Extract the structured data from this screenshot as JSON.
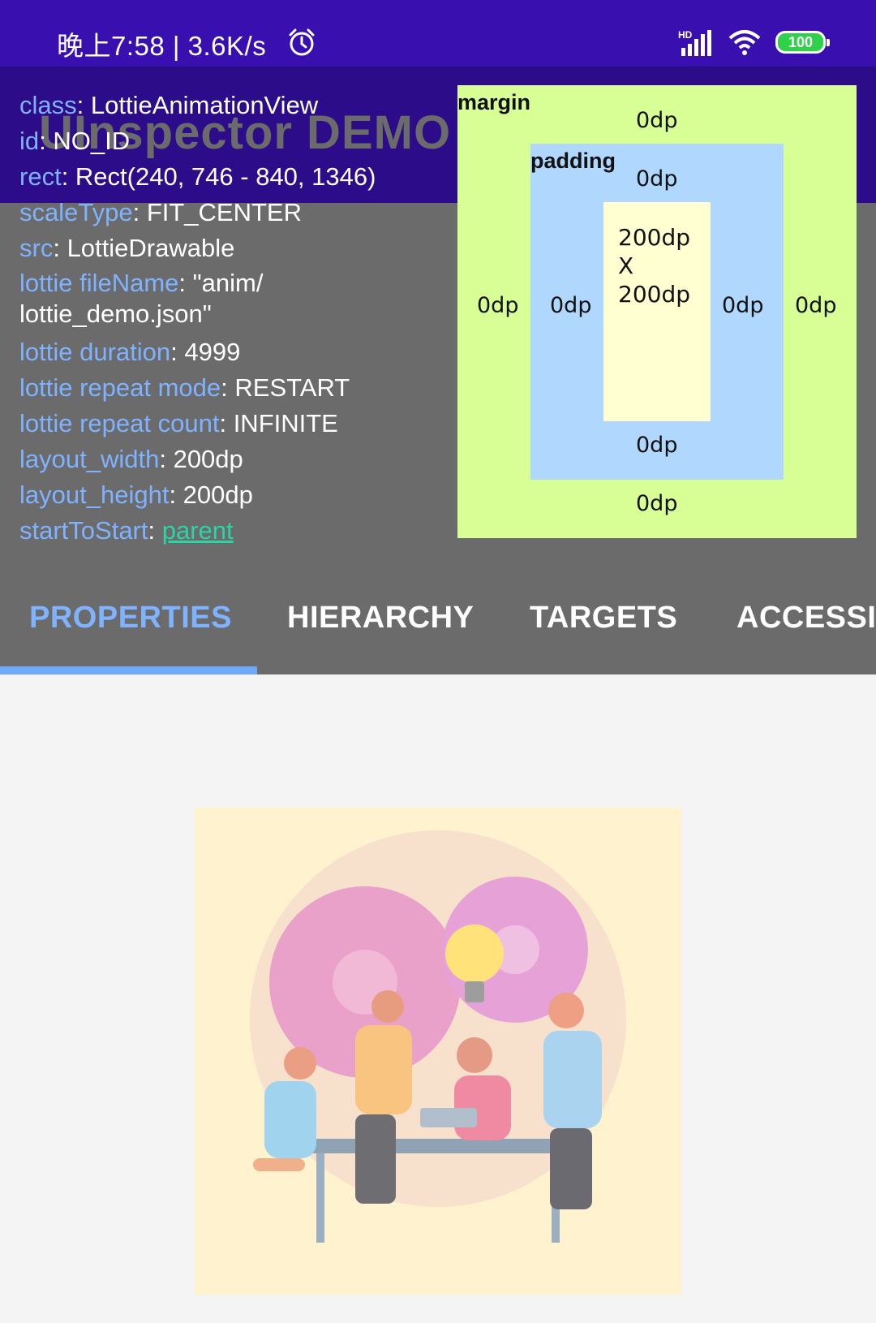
{
  "status_bar": {
    "time": "晚上7:58",
    "speed": "3.6K/s",
    "network": "HD",
    "battery": "100"
  },
  "app": {
    "title": "UInspector DEMO"
  },
  "properties": [
    {
      "key": "class",
      "value": "LottieAnimationView"
    },
    {
      "key": "id",
      "value": "NO_ID"
    },
    {
      "key": "rect",
      "value": "Rect(240, 746 - 840, 1346)"
    },
    {
      "key": "scaleType",
      "value": "FIT_CENTER"
    },
    {
      "key": "src",
      "value": "LottieDrawable"
    },
    {
      "key": "lottie fileName",
      "value": "\"anim/\nlottie_demo.json\""
    },
    {
      "key": "lottie duration",
      "value": "4999"
    },
    {
      "key": "lottie repeat mode",
      "value": "RESTART"
    },
    {
      "key": "lottie repeat count",
      "value": "INFINITE"
    },
    {
      "key": "layout_width",
      "value": "200dp"
    },
    {
      "key": "layout_height",
      "value": "200dp"
    },
    {
      "key": "startToStart",
      "value": "parent"
    }
  ],
  "box_model": {
    "margin_label": "margin",
    "padding_label": "padding",
    "margin": {
      "top": "0dp",
      "bottom": "0dp",
      "left": "0dp",
      "right": "0dp"
    },
    "padding": {
      "top": "0dp",
      "bottom": "0dp",
      "left": "0dp",
      "right": "0dp"
    },
    "size_width": "200dp",
    "size_x": "X",
    "size_height": "200dp"
  },
  "tabs": [
    {
      "label": "PROPERTIES",
      "active": true
    },
    {
      "label": "HIERARCHY",
      "active": false
    },
    {
      "label": "TARGETS",
      "active": false
    },
    {
      "label": "ACCESSI",
      "active": false
    }
  ],
  "colors": {
    "status_bar": "#3a0fb0",
    "app_bar": "#2d0c8a",
    "overlay": "#6b6b6b",
    "key_text": "#7fb2ff",
    "link_text": "#2bd4a6",
    "margin_box": "#d8ff96",
    "padding_box": "#b0d8ff",
    "content_box": "#ffffd2",
    "tab_indicator": "#6ea8f7"
  }
}
